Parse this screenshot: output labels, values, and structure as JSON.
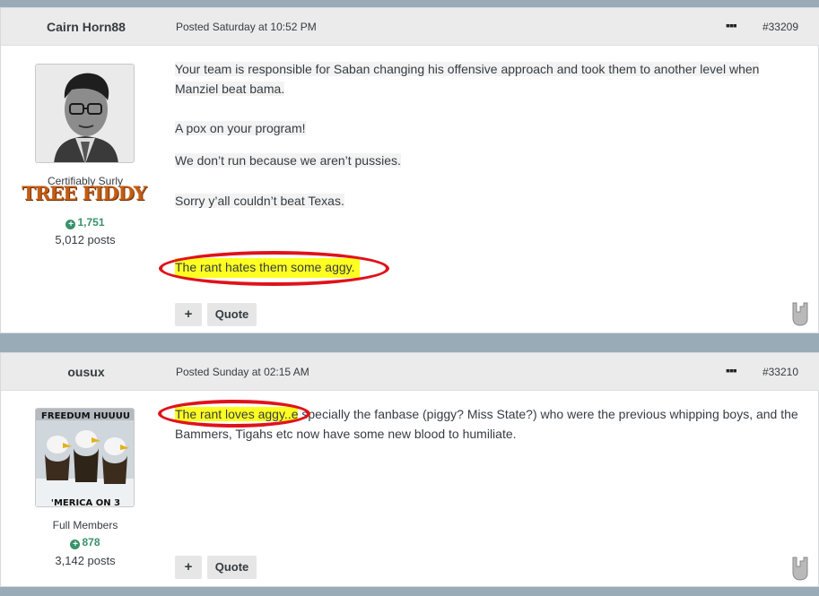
{
  "posts": [
    {
      "author": "Cairn Horn88",
      "date": "Posted Saturday at 10:52 PM",
      "number": "#33209",
      "group": "Certifiably Surly",
      "badge": "TREE FIDDY",
      "reputation": "1,751",
      "post_count": "5,012 posts",
      "paragraphs": [
        "Your team is responsible for Saban changing his offensive approach and took them to another level when Manziel beat bama.",
        "A pox on your program!",
        "We don’t run because we aren’t pussies.",
        "Sorry y’all couldn’t beat Texas.",
        "The rant hates them some aggy."
      ],
      "buttons": {
        "plus": "+",
        "quote": "Quote"
      }
    },
    {
      "author": "ousux",
      "date": "Posted Sunday at 02:15 AM",
      "number": "#33210",
      "group": "Full Members",
      "reputation": "878",
      "post_count": "3,142 posts",
      "avatar_text_top": "FREEDUM HUUUU",
      "avatar_text_bottom": "'MERICA ON 3",
      "paragraph_lead": "The rant loves aggy..e",
      "paragraph_rest": "specially the fanbase (piggy? Miss State?) who were the previous whipping boys, and the Bammers, Tigahs etc now have some new blood to humiliate.",
      "buttons": {
        "plus": "+",
        "quote": "Quote"
      }
    }
  ],
  "icons": {
    "menu": "ellipsis-icon",
    "reaction": "rock-on-hand-icon",
    "rep": "plus-circle-icon"
  }
}
